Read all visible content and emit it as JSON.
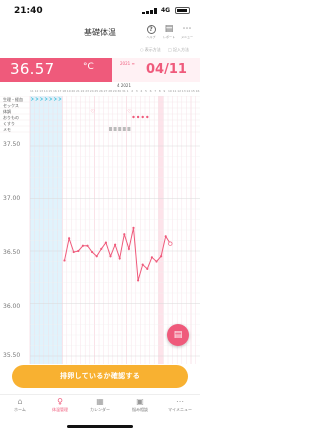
{
  "status": {
    "time": "21:40",
    "network": "4G"
  },
  "header": {
    "title": "基礎体温",
    "icons": [
      {
        "name": "help-icon",
        "glyph": "?",
        "label": "ヘルプ"
      },
      {
        "name": "report-icon",
        "glyph": "▤",
        "label": "レポート"
      },
      {
        "name": "menu-icon",
        "glyph": "⋯",
        "label": "メニュー"
      }
    ],
    "subbar": [
      "○ 表示方法",
      "□ 記入方法"
    ]
  },
  "temp": {
    "value": "36.57",
    "unit": "°C"
  },
  "date": {
    "year": "2021 ≡",
    "value": "04/11"
  },
  "dayhead": {
    "month": "4 2021",
    "days": [
      "11",
      "12",
      "13",
      "14",
      "15",
      "16",
      "17",
      "18",
      "19",
      "20",
      "21",
      "22",
      "23",
      "24",
      "25",
      "26",
      "27",
      "28",
      "29",
      "30",
      "31",
      "1",
      "2",
      "3",
      "4",
      "5",
      "6",
      "7",
      "8",
      "9",
      "10",
      "11",
      "12",
      "13",
      "14",
      "15",
      "16"
    ]
  },
  "event_rows": [
    "生理・経血",
    "セックス",
    "体調",
    "おりもの",
    "くすり",
    "メモ"
  ],
  "axis": {
    "ticks": [
      "37.50",
      "37.00",
      "36.50",
      "36.00",
      "35.50"
    ]
  },
  "chart_data": {
    "type": "line",
    "y_range": [
      35.5,
      37.5
    ],
    "series": [
      {
        "values": [
          36.41,
          36.62,
          36.49,
          36.5,
          36.55,
          36.55,
          36.49,
          36.45,
          36.52,
          36.58,
          36.45,
          36.56,
          36.43,
          36.66,
          36.52,
          36.72,
          36.22,
          36.37,
          36.33,
          36.44,
          36.4,
          36.45,
          36.64,
          36.57
        ]
      }
    ]
  },
  "colors": {
    "accent": "#ef5a7b",
    "cta": "#f8b131",
    "period_band": "#d5effb"
  },
  "fab": {
    "glyph": "▤"
  },
  "cta_label": "排卵しているか確認する",
  "tabs": [
    {
      "name": "tab-home",
      "glyph": "⌂",
      "label": "ホーム",
      "active": false
    },
    {
      "name": "tab-bbt",
      "glyph": "♀",
      "label": "体温管理",
      "active": true
    },
    {
      "name": "tab-calendar",
      "glyph": "▦",
      "label": "カレンダー",
      "active": false
    },
    {
      "name": "tab-consult",
      "glyph": "▣",
      "label": "悩み相談",
      "active": false
    },
    {
      "name": "tab-mypage",
      "glyph": "⋯",
      "label": "マイメニュー",
      "active": false
    }
  ]
}
